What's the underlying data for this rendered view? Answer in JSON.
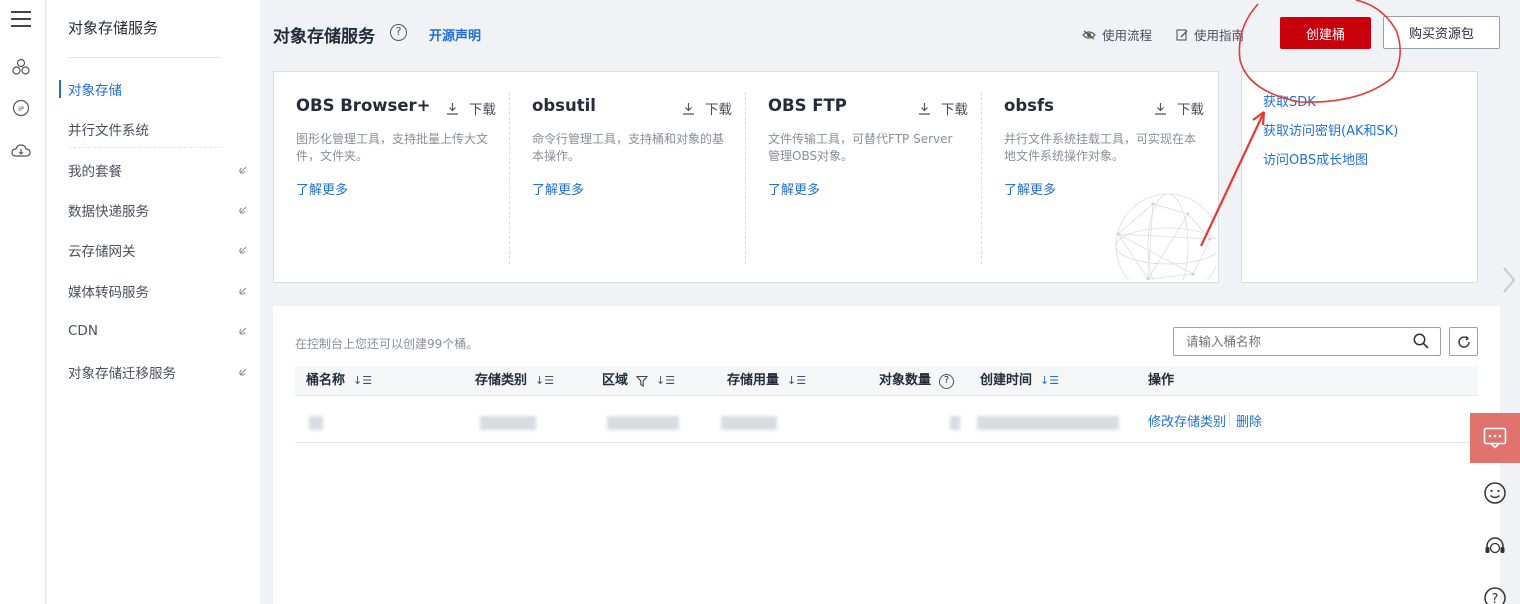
{
  "rail": {
    "icons": [
      "menu-icon",
      "cluster-icon",
      "ip-icon",
      "cloud-icon"
    ]
  },
  "sidebar": {
    "title": "对象存储服务",
    "items": [
      {
        "label": "对象存储",
        "active": true,
        "external": false
      },
      {
        "label": "并行文件系统",
        "active": false,
        "external": false
      },
      {
        "label": "我的套餐",
        "active": false,
        "external": true
      },
      {
        "label": "数据快递服务",
        "active": false,
        "external": true
      },
      {
        "label": "云存储网关",
        "active": false,
        "external": true
      },
      {
        "label": "媒体转码服务",
        "active": false,
        "external": true
      },
      {
        "label": "CDN",
        "active": false,
        "external": true
      },
      {
        "label": "对象存储迁移服务",
        "active": false,
        "external": true
      }
    ]
  },
  "header": {
    "title": "对象存储服务",
    "open_source": "开源声明",
    "usage_flow": "使用流程",
    "usage_guide": "使用指南",
    "create_bucket": "创建桶",
    "buy_package": "购买资源包"
  },
  "tools": [
    {
      "name": "OBS Browser+",
      "download": "下载",
      "desc": "图形化管理工具，支持批量上传大文件，文件夹。",
      "more": "了解更多"
    },
    {
      "name": "obsutil",
      "download": "下载",
      "desc": "命令行管理工具，支持桶和对象的基本操作。",
      "more": "了解更多"
    },
    {
      "name": "OBS FTP",
      "download": "下载",
      "desc": "文件传输工具，可替代FTP Server管理OBS对象。",
      "more": "了解更多"
    },
    {
      "name": "obsfs",
      "download": "下载",
      "desc": "并行文件系统挂载工具，可实现在本地文件系统操作对象。",
      "more": "了解更多"
    }
  ],
  "links": [
    "获取SDK",
    "获取访问密钥(AK和SK)",
    "访问OBS成长地图"
  ],
  "list": {
    "quota_text": "在控制台上您还可以创建99个桶。",
    "search_placeholder": "请输入桶名称",
    "columns": [
      "桶名称",
      "存储类别",
      "区域",
      "存储用量",
      "对象数量",
      "创建时间",
      "操作"
    ],
    "row_actions": {
      "modify": "修改存储类别",
      "delete": "删除"
    }
  },
  "colors": {
    "accent": "#c7000b",
    "link": "#1f6fd6",
    "annotation": "#e8392f"
  }
}
